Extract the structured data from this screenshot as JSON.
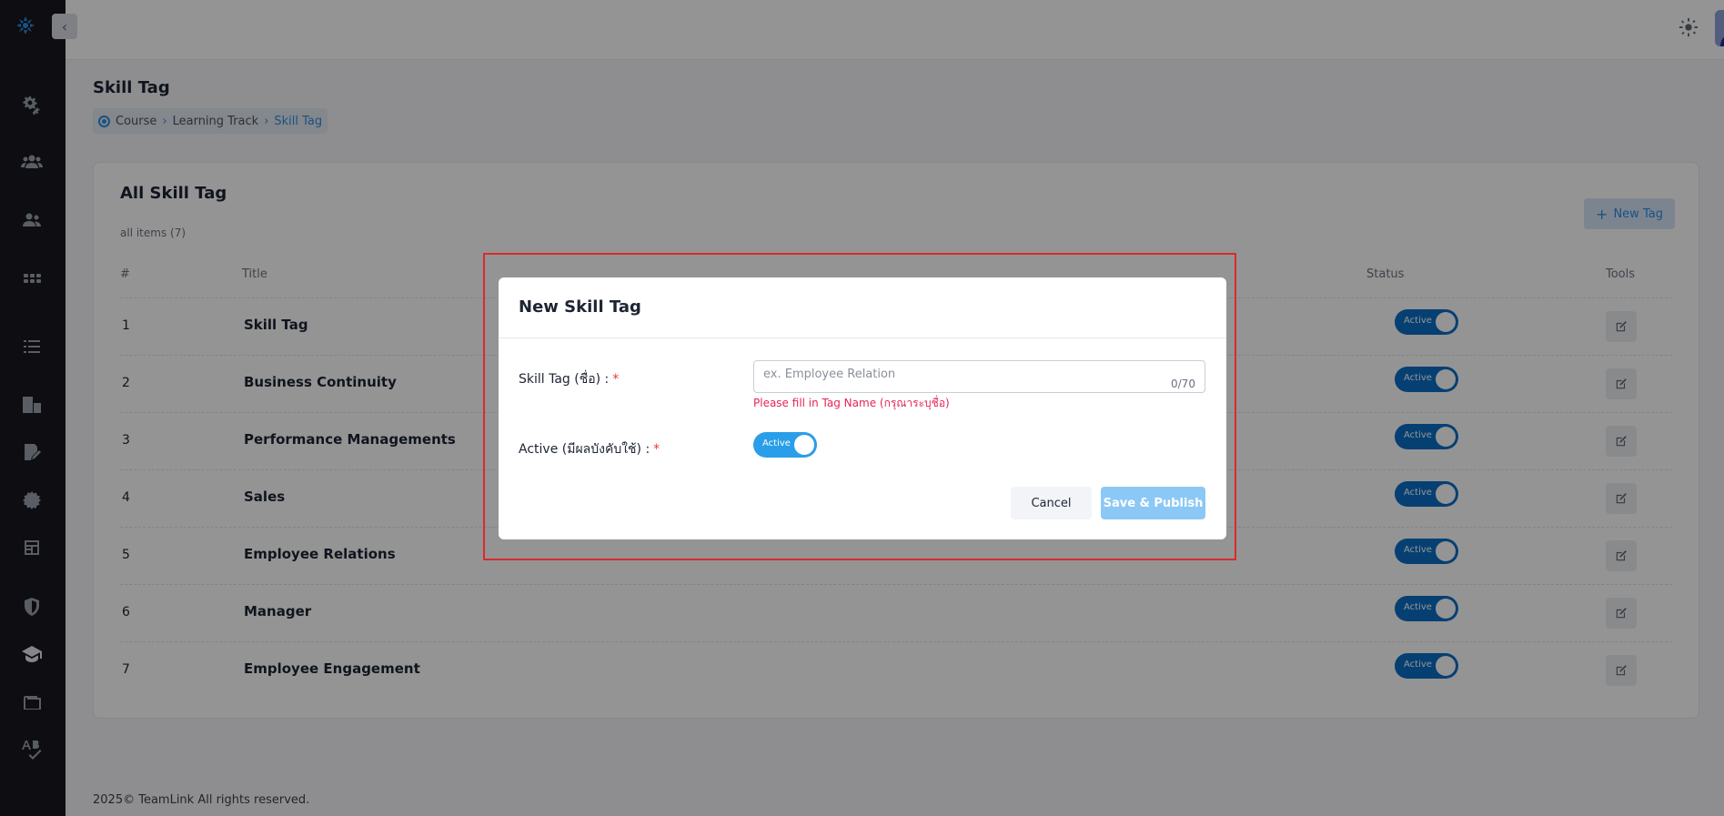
{
  "app": {
    "footer": "2025© TeamLink All rights reserved."
  },
  "page": {
    "title": "Skill Tag",
    "breadcrumb": [
      "Course",
      "Learning Track",
      "Skill Tag"
    ]
  },
  "card": {
    "title": "All Skill Tag",
    "count": "all items (7)",
    "new_button": "New Tag",
    "columns": [
      "#",
      "Title",
      "Status",
      "Tools"
    ],
    "rows": [
      {
        "num": "1",
        "title": "Skill Tag",
        "status": "Active"
      },
      {
        "num": "2",
        "title": "Business Continuity",
        "status": "Active"
      },
      {
        "num": "3",
        "title": "Performance Managements",
        "status": "Active"
      },
      {
        "num": "4",
        "title": "Sales",
        "status": "Active"
      },
      {
        "num": "5",
        "title": "Employee Relations",
        "status": "Active"
      },
      {
        "num": "6",
        "title": "Manager",
        "status": "Active"
      },
      {
        "num": "7",
        "title": "Employee Engagement",
        "status": "Active"
      }
    ]
  },
  "modal": {
    "title": "New Skill Tag",
    "tag_label": "Skill Tag (ชื่อ) :",
    "tag_placeholder": "ex. Employee Relation",
    "tag_counter": "0/70",
    "tag_error": "Please fill in Tag Name (กรุณาระบุชื่อ)",
    "active_label": "Active (มีผลบังคับใช้) :",
    "active_toggle": "Active",
    "required_mark": "*",
    "cancel": "Cancel",
    "save": "Save & Publish"
  },
  "colors": {
    "accent": "#2a8ee6",
    "toggle_on": "#0b6fc7",
    "error": "#e5245a",
    "highlight": "#d92b2b"
  },
  "icons": {
    "sidebar": [
      "settings-gears-icon",
      "users-icon",
      "user-group-icon",
      "apps-grid-icon",
      "list-icon",
      "org-chart-icon",
      "edit-document-icon",
      "gear-badge-icon",
      "news-icon",
      "shield-icon",
      "graduation-cap-icon",
      "wallet-icon",
      "spellcheck-icon"
    ]
  }
}
